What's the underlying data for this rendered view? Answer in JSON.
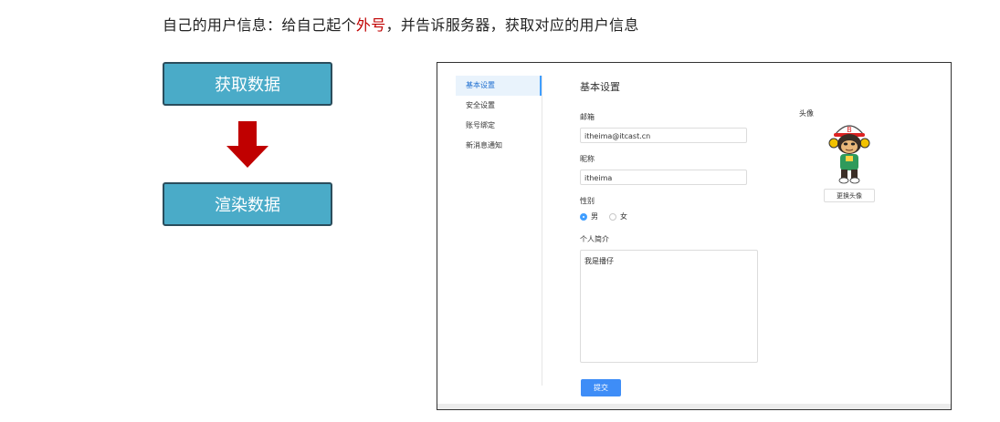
{
  "headline": {
    "prefix": "自己的用户信息：给自己起个",
    "highlight": "外号",
    "suffix": "，并告诉服务器，获取对应的用户信息"
  },
  "flow": {
    "step1": "获取数据",
    "step2": "渲染数据"
  },
  "colors": {
    "flow_box": "#4aabc8",
    "arrow": "#c00000",
    "highlight": "#c00000",
    "accent": "#409eff"
  },
  "settings": {
    "nav": [
      "基本设置",
      "安全设置",
      "账号绑定",
      "新消息通知"
    ],
    "active_nav": "基本设置",
    "title": "基本设置",
    "email_label": "邮箱",
    "email_value": "itheima@itcast.cn",
    "nickname_label": "昵称",
    "nickname_value": "itheima",
    "gender_label": "性别",
    "gender_options": [
      "男",
      "女"
    ],
    "gender_selected": "男",
    "bio_label": "个人简介",
    "bio_value": "我是播仔",
    "submit_label": "提交",
    "avatar_label": "头像",
    "change_avatar_label": "更换头像",
    "avatar_icon": "cartoon-monkey-avatar"
  }
}
